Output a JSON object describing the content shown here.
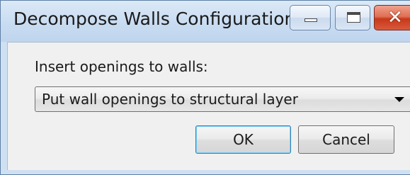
{
  "window": {
    "title": "Decompose Walls Configuration",
    "minimize_icon": "minimize-icon",
    "maximize_icon": "maximize-icon",
    "close_icon": "close-icon",
    "close_glyph": "✕",
    "close_color": "#c8381a"
  },
  "form": {
    "label": "Insert openings to walls:",
    "openings_select": {
      "value": "Put wall openings to structural layer",
      "arrow_icon": "chevron-down-icon"
    }
  },
  "buttons": {
    "ok_label": "OK",
    "cancel_label": "Cancel"
  },
  "colors": {
    "titlebar": "#c9dcf1",
    "client_background": "#f0f0f0",
    "default_button_border": "#3c7fb1"
  }
}
